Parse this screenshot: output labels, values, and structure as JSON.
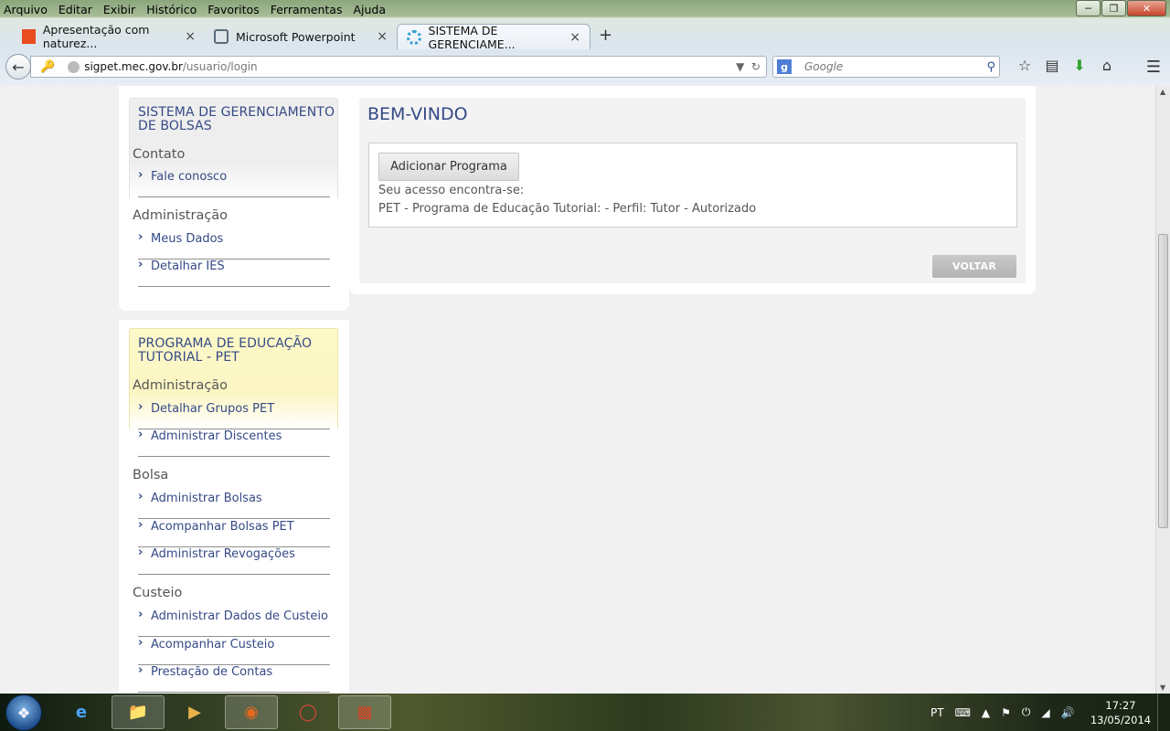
{
  "browser": {
    "menu": [
      "Arquivo",
      "Editar",
      "Exibir",
      "Histórico",
      "Favoritos",
      "Ferramentas",
      "Ajuda"
    ],
    "tabs": [
      {
        "label": "Apresentação com naturez...",
        "icon": "office-icon",
        "color": "#e84c1f"
      },
      {
        "label": "Microsoft Powerpoint",
        "icon": "network-icon",
        "color": "#5a6a7a"
      },
      {
        "label": "SISTEMA DE GERENCIAME...",
        "icon": "loading-icon",
        "color": "#33a0d6"
      }
    ],
    "new_tab": "+",
    "url_domain": "sigpet.mec.gov.br",
    "url_path": "/usuario/login",
    "search_placeholder": "Google"
  },
  "sidebar1": {
    "title": "SISTEMA DE GERENCIAMENTO DE BOLSAS",
    "groups": [
      {
        "label": "Contato",
        "items": [
          "Fale conosco"
        ]
      },
      {
        "label": "Administração",
        "items": [
          "Meus Dados",
          "Detalhar IES"
        ]
      }
    ]
  },
  "sidebar2": {
    "title": "PROGRAMA DE EDUCAÇÃO TUTORIAL - PET",
    "groups": [
      {
        "label": "Administração",
        "items": [
          "Detalhar Grupos PET",
          "Administrar Discentes"
        ]
      },
      {
        "label": "Bolsa",
        "items": [
          "Administrar Bolsas",
          "Acompanhar Bolsas PET",
          "Administrar Revogações"
        ]
      },
      {
        "label": "Custeio",
        "items": [
          "Administrar Dados de Custeio",
          "Acompanhar Custeio",
          "Prestação de Contas"
        ]
      }
    ]
  },
  "main": {
    "title": "BEM-VINDO",
    "add_button": "Adicionar Programa",
    "access_label": "Seu acesso encontra-se:",
    "access_detail": "PET - Programa de Educação Tutorial: - Perfil: Tutor - Autorizado",
    "back_button": "VOLTAR"
  },
  "taskbar": {
    "language": "PT",
    "time": "17:27",
    "date": "13/05/2014"
  }
}
